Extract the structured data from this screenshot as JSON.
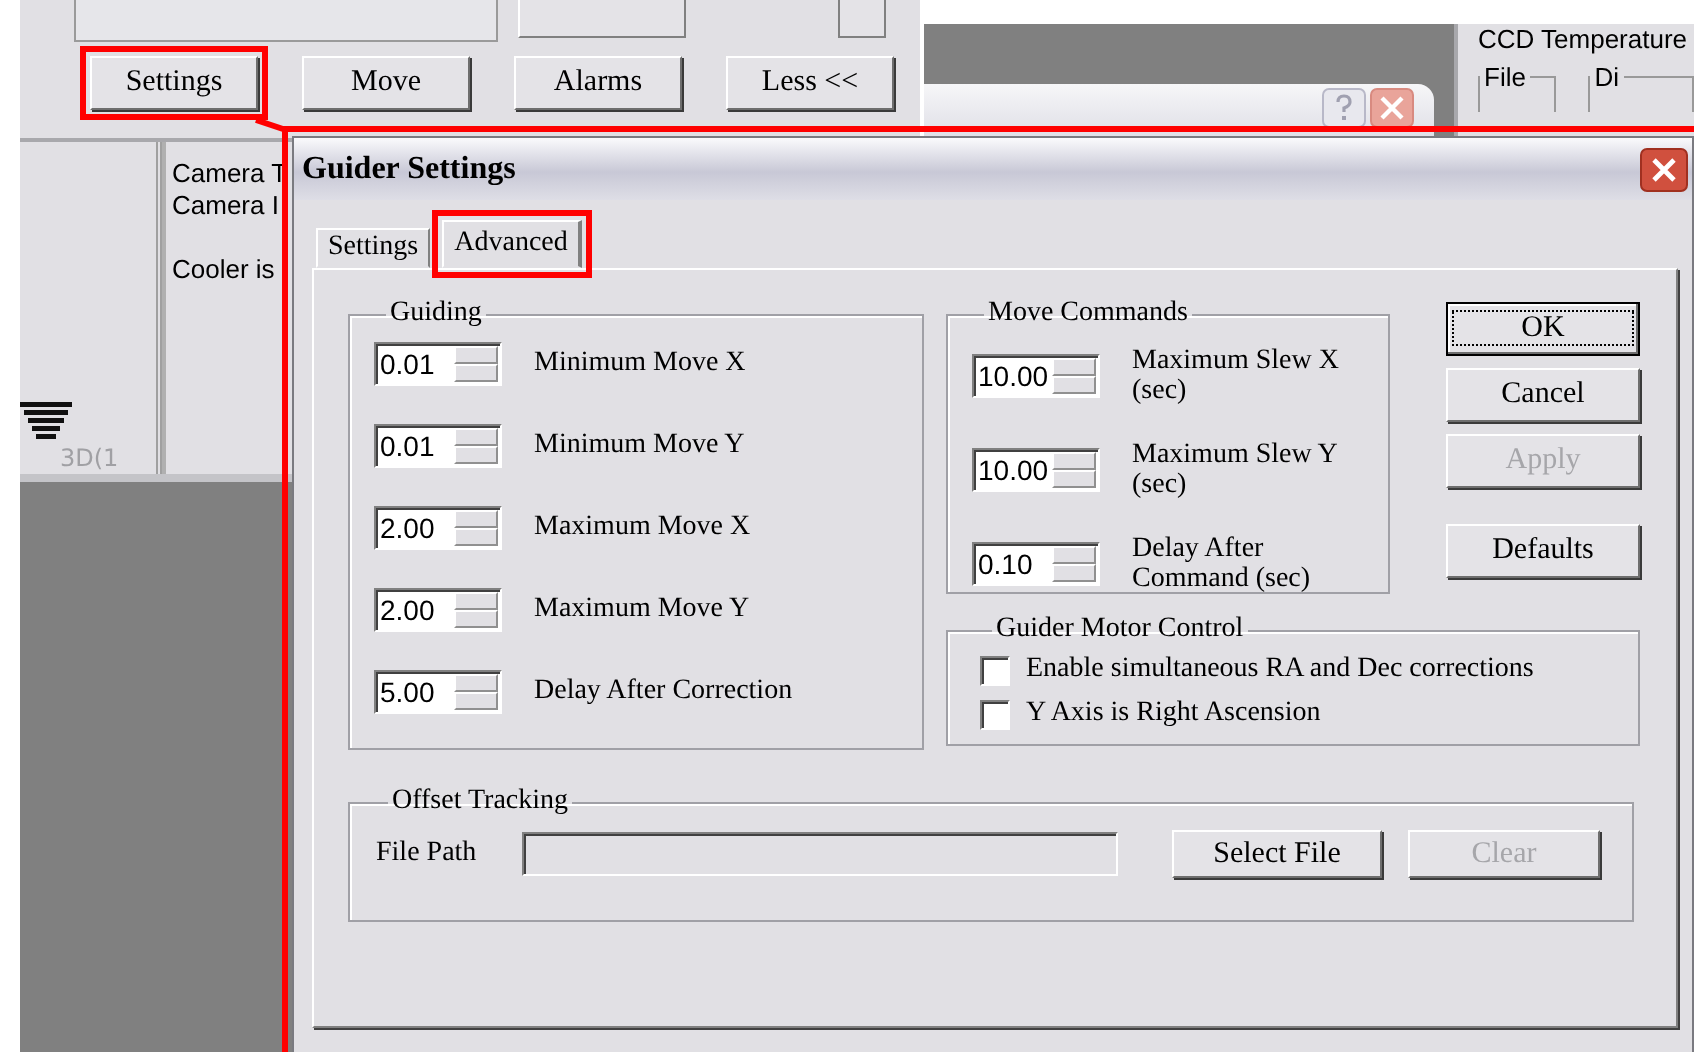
{
  "background_window": {
    "top_controls": [
      {
        "kind": "textbox"
      },
      {
        "kind": "button"
      },
      {
        "kind": "arrow_button"
      }
    ],
    "buttons": [
      {
        "label": "Settings",
        "highlighted": true
      },
      {
        "label": "Move",
        "highlighted": false
      },
      {
        "label": "Alarms",
        "highlighted": false
      },
      {
        "label": "Less <<",
        "highlighted": false
      }
    ],
    "status_lines": [
      "Camera T",
      "Camera I",
      "Cooler is"
    ],
    "image_label": "3D(1",
    "right_panel": {
      "title": "CCD Temperature",
      "groups": [
        "File",
        "Di"
      ]
    }
  },
  "dialog": {
    "title": "Guider Settings",
    "highlighted": true,
    "tabs": [
      {
        "label": "Settings",
        "selected": false,
        "highlighted": false
      },
      {
        "label": "Advanced",
        "selected": true,
        "highlighted": true
      }
    ],
    "guiding": {
      "title": "Guiding",
      "rows": [
        {
          "value": "0.01",
          "label": "Minimum Move X"
        },
        {
          "value": "0.01",
          "label": "Minimum Move Y"
        },
        {
          "value": "2.00",
          "label": "Maximum Move X"
        },
        {
          "value": "2.00",
          "label": "Maximum Move Y"
        },
        {
          "value": "5.00",
          "label": "Delay After Correction"
        }
      ]
    },
    "move_commands": {
      "title": "Move Commands",
      "rows": [
        {
          "value": "10.00",
          "label": "Maximum Slew X (sec)"
        },
        {
          "value": "10.00",
          "label": "Maximum Slew Y (sec)"
        },
        {
          "value": "0.10",
          "label": "Delay After Command (sec)"
        }
      ]
    },
    "buttons": [
      {
        "label": "OK",
        "default": true,
        "disabled": false
      },
      {
        "label": "Cancel",
        "default": false,
        "disabled": false
      },
      {
        "label": "Apply",
        "default": false,
        "disabled": true
      },
      {
        "label": "Defaults",
        "default": false,
        "disabled": false
      }
    ],
    "motor_control": {
      "title": "Guider Motor Control",
      "options": [
        {
          "label": "Enable simultaneous RA and Dec corrections",
          "checked": false
        },
        {
          "label": "Y Axis is Right Ascension",
          "checked": false
        }
      ]
    },
    "offset_tracking": {
      "title": "Offset Tracking",
      "field_label": "File Path",
      "buttons": [
        {
          "label": "Select File",
          "disabled": false
        },
        {
          "label": "Clear",
          "disabled": true
        }
      ]
    }
  }
}
